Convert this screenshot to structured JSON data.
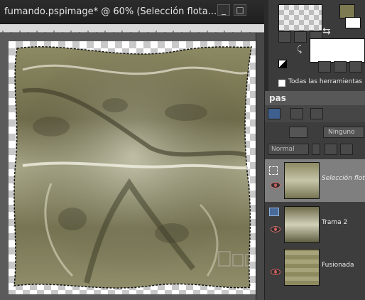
{
  "document": {
    "title": "fumando.pspimage* @  60% (Selección flota..."
  },
  "window_controls": {
    "minimize": "_",
    "maximize": "□"
  },
  "materials": {
    "all_tools_label": "Todas las herramientas"
  },
  "layers_panel": {
    "title": "pas",
    "blend_mode": "Normal",
    "mask_label": "Ninguno",
    "layers": [
      {
        "name": "Selección flotante",
        "selected": true
      },
      {
        "name": "Trama 2",
        "selected": false
      },
      {
        "name": "Fusionada",
        "selected": false
      }
    ]
  },
  "colors": {
    "foreground_swatch": "#7d7a52",
    "background_swatch": "#ffffff"
  }
}
